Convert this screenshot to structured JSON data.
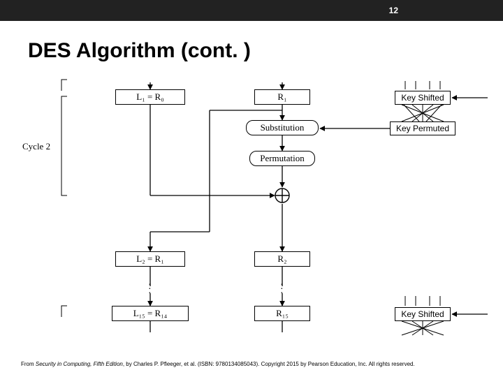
{
  "page_number": "12",
  "title": "DES Algorithm (cont. )",
  "diagram": {
    "cycle_label": "Cycle 2",
    "l1": "L₁ = R₀",
    "r1": "R₁",
    "substitution": "Substitution",
    "permutation": "Permutation",
    "key_shifted": "Key Shifted",
    "key_permuted": "Key Permuted",
    "l2": "L₂ = R₁",
    "r2": "R₂",
    "l15": "L₁₅ = R₁₄",
    "r15": "R₁₅",
    "key_shifted_bottom": "Key Shifted"
  },
  "footer": {
    "prefix": "From ",
    "book": "Security in Computing, Fifth Edition",
    "rest": ", by Charles P. Pfleeger, et al. (ISBN: 9780134085043). Copyright 2015 by Pearson Education, Inc. All rights reserved."
  }
}
